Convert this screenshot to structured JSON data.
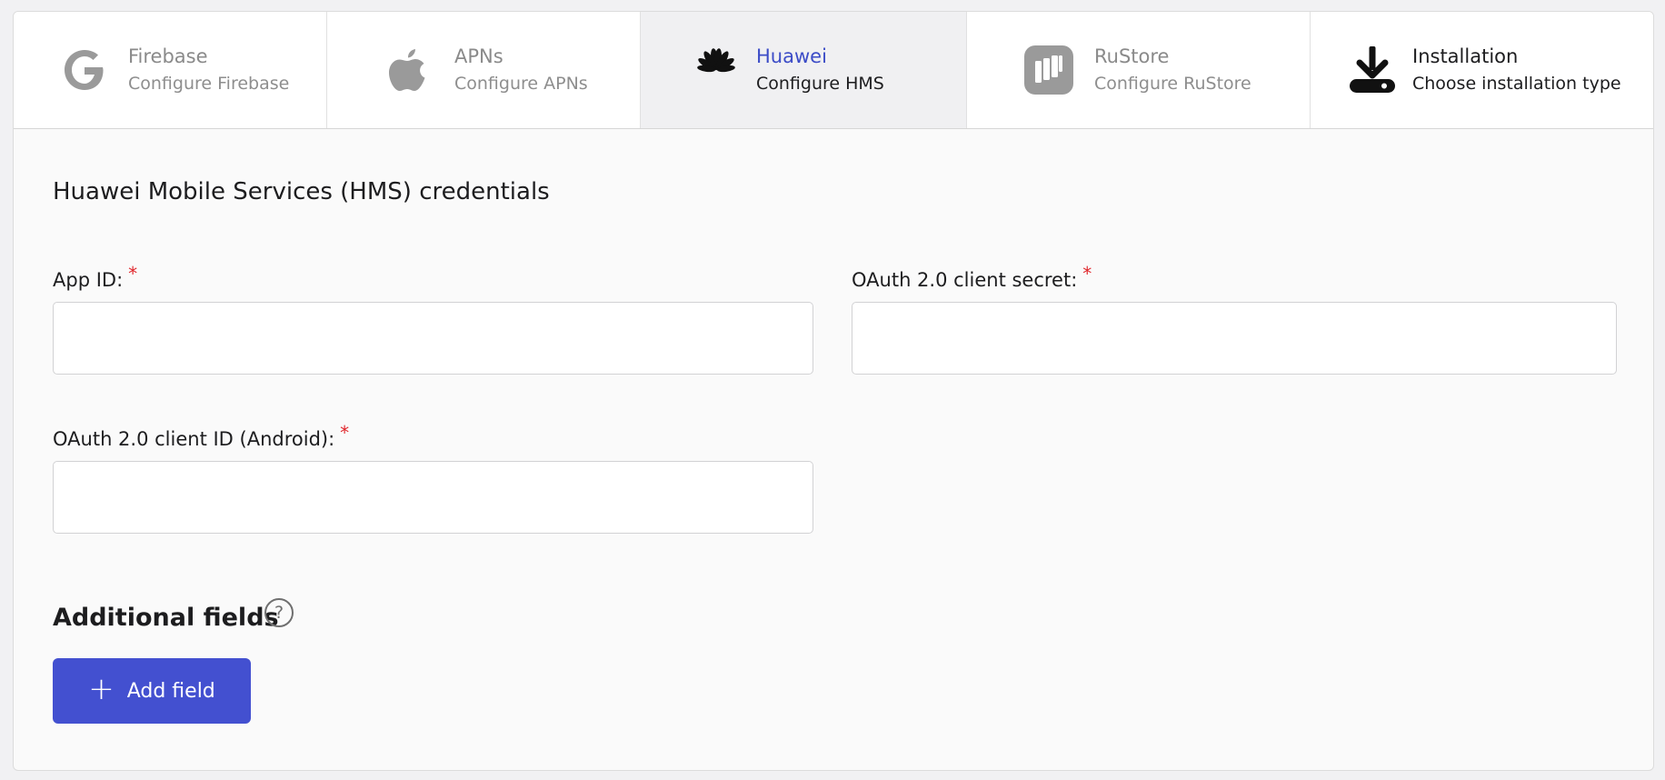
{
  "tabs": [
    {
      "title": "Firebase",
      "subtitle": "Configure Firebase",
      "icon": "google-icon"
    },
    {
      "title": "APNs",
      "subtitle": "Configure APNs",
      "icon": "apple-icon"
    },
    {
      "title": "Huawei",
      "subtitle": "Configure HMS",
      "icon": "huawei-icon"
    },
    {
      "title": "RuStore",
      "subtitle": "Configure RuStore",
      "icon": "rustore-icon"
    },
    {
      "title": "Installation",
      "subtitle": "Choose installation type",
      "icon": "download-icon"
    }
  ],
  "active_tab": "Huawei",
  "form": {
    "title": "Huawei Mobile Services (HMS) credentials",
    "required_mark": "*",
    "app_id": {
      "label": "App ID:",
      "value": ""
    },
    "client_secret": {
      "label": "OAuth 2.0 client secret:",
      "value": ""
    },
    "client_id": {
      "label": "OAuth 2.0 client ID (Android):",
      "value": ""
    }
  },
  "additional": {
    "title": "Additional fields",
    "help_glyph": "?",
    "add_button_label": "Add field",
    "add_button_icon": "plus-icon"
  },
  "colors": {
    "accent": "#3c4cc7",
    "button": "#4350d0",
    "required": "#e0262b",
    "active_tab_bg": "#f0f0f2"
  }
}
